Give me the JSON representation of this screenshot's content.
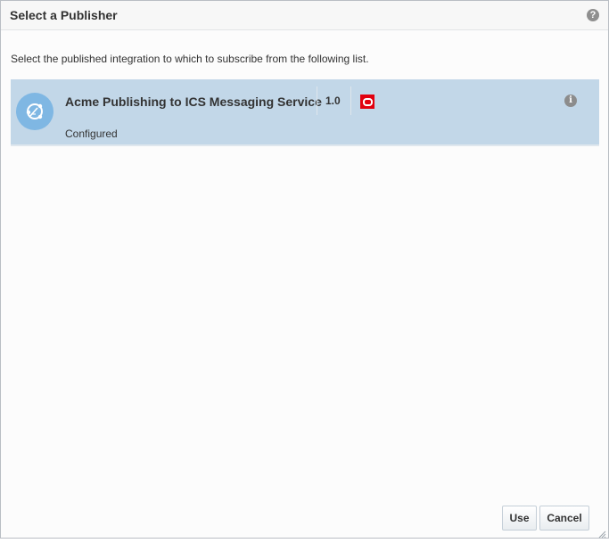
{
  "dialog": {
    "title": "Select a Publisher",
    "help_icon": "question-circle-icon",
    "help_glyph": "?",
    "instruction": "Select the published integration to which to subscribe from the following list."
  },
  "publishers": [
    {
      "name": "Acme Publishing to ICS Messaging Service",
      "version": "1.0",
      "status": "Configured",
      "icon": "integration-icon",
      "vendor_icon": "oracle-icon",
      "info_glyph": "i"
    }
  ],
  "buttons": {
    "use": "Use",
    "cancel": "Cancel"
  },
  "colors": {
    "selected_row": "#c2d7e8",
    "integration_icon": "#7fb7e3",
    "oracle_red": "#e2000f"
  }
}
